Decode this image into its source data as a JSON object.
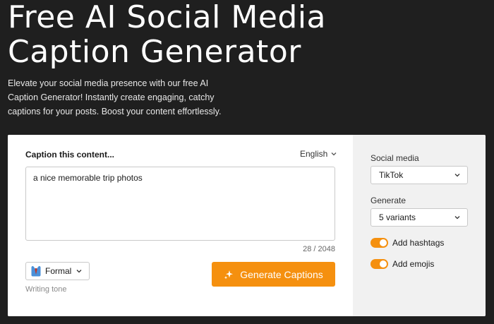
{
  "hero": {
    "title": "Free AI Social Media\nCaption Generator",
    "subtitle": "Elevate your social media presence with our free AI Caption Generator! Instantly create engaging, catchy captions for your posts. Boost your content effortlessly."
  },
  "form": {
    "caption_label": "Caption this content...",
    "language": "English",
    "content_value": "a nice memorable trip photos",
    "char_count": "28 / 2048",
    "tone": {
      "value": "Formal",
      "label": "Writing tone"
    },
    "generate_label": "Generate Captions"
  },
  "options": {
    "social_media_label": "Social media",
    "social_media_value": "TikTok",
    "generate_label": "Generate",
    "generate_value": "5 variants",
    "hashtags_label": "Add hashtags",
    "hashtags_on": true,
    "emojis_label": "Add emojis",
    "emojis_on": true
  },
  "colors": {
    "background": "#1f1f1f",
    "accent": "#f5900f",
    "panel": "#f1f1f1"
  }
}
